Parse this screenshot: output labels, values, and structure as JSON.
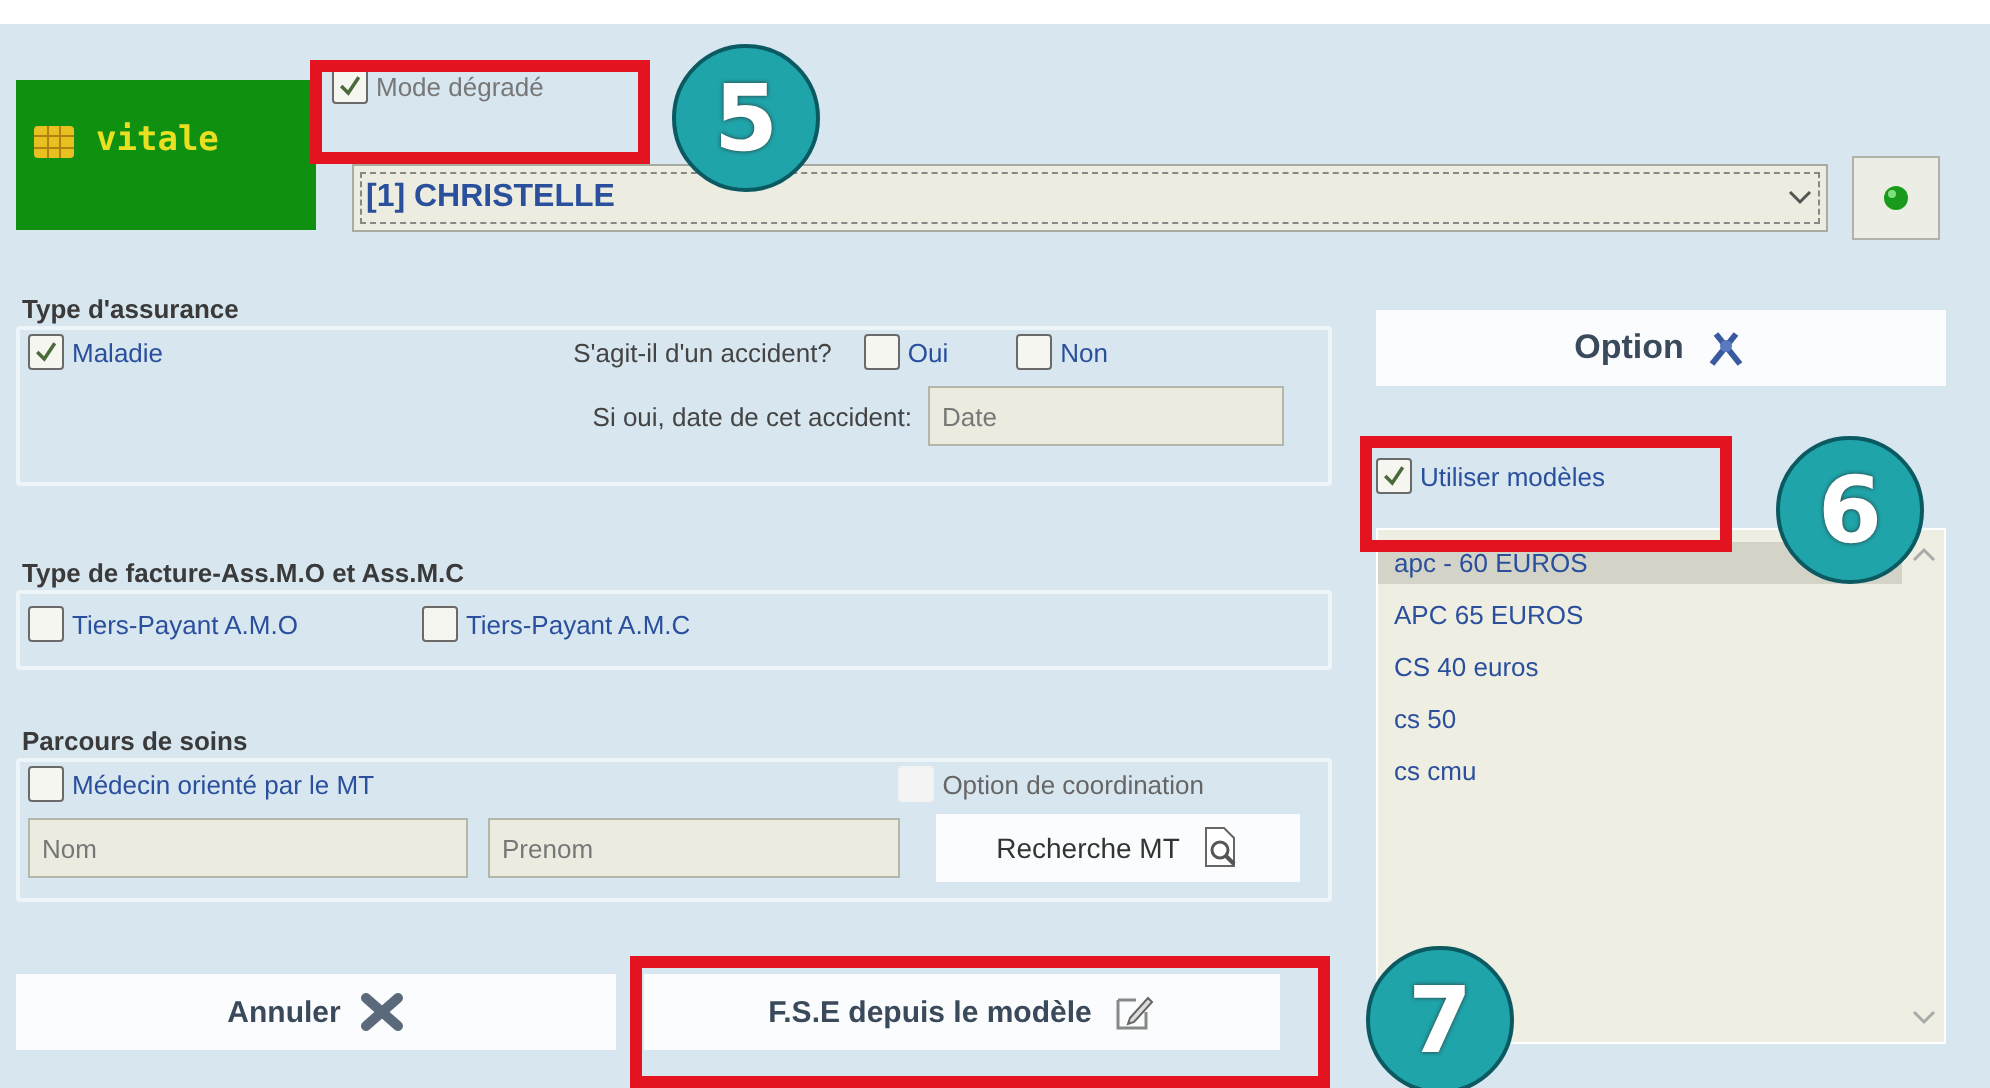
{
  "card": {
    "brand": "vitale"
  },
  "degraded_mode": {
    "label": "Mode dégradé",
    "checked": true
  },
  "patient_select": {
    "value": "[1] CHRISTELLE"
  },
  "insurance": {
    "title": "Type d'assurance",
    "maladie": {
      "label": "Maladie",
      "checked": true
    },
    "accident_question": "S'agit-il d'un accident?",
    "accident_options": [
      {
        "label": "Oui",
        "checked": false
      },
      {
        "label": "Non",
        "checked": false
      }
    ],
    "date_label": "Si oui, date de cet accident:",
    "date_field": {
      "placeholder": "Date"
    }
  },
  "invoice_type": {
    "title": "Type de facture-Ass.M.O et Ass.M.C",
    "options": [
      {
        "label": "Tiers-Payant A.M.O",
        "checked": false
      },
      {
        "label": "Tiers-Payant A.M.C",
        "checked": false
      }
    ]
  },
  "care_path": {
    "title": "Parcours de soins",
    "referred": {
      "label": "Médecin orienté par le MT",
      "checked": false
    },
    "coordination": {
      "label": "Option de coordination",
      "checked": false,
      "disabled": true
    },
    "name_fields": [
      {
        "placeholder": "Nom"
      },
      {
        "placeholder": "Prenom"
      }
    ],
    "search_button": "Recherche MT"
  },
  "option_button": "Option",
  "models": {
    "use_models": {
      "label": "Utiliser modèles",
      "checked": true
    },
    "items": [
      {
        "label": "apc - 60 EUROS",
        "selected": true
      },
      {
        "label": "APC 65 EUROS",
        "selected": false
      },
      {
        "label": "CS 40 euros",
        "selected": false
      },
      {
        "label": "cs 50",
        "selected": false
      },
      {
        "label": "cs cmu",
        "selected": false
      }
    ]
  },
  "buttons": [
    {
      "label": "Annuler",
      "kind": "cancel"
    },
    {
      "label": "F.S.E depuis le modèle",
      "kind": "edit"
    }
  ],
  "callouts": [
    {
      "number": "5"
    },
    {
      "number": "6"
    },
    {
      "number": "7"
    }
  ]
}
